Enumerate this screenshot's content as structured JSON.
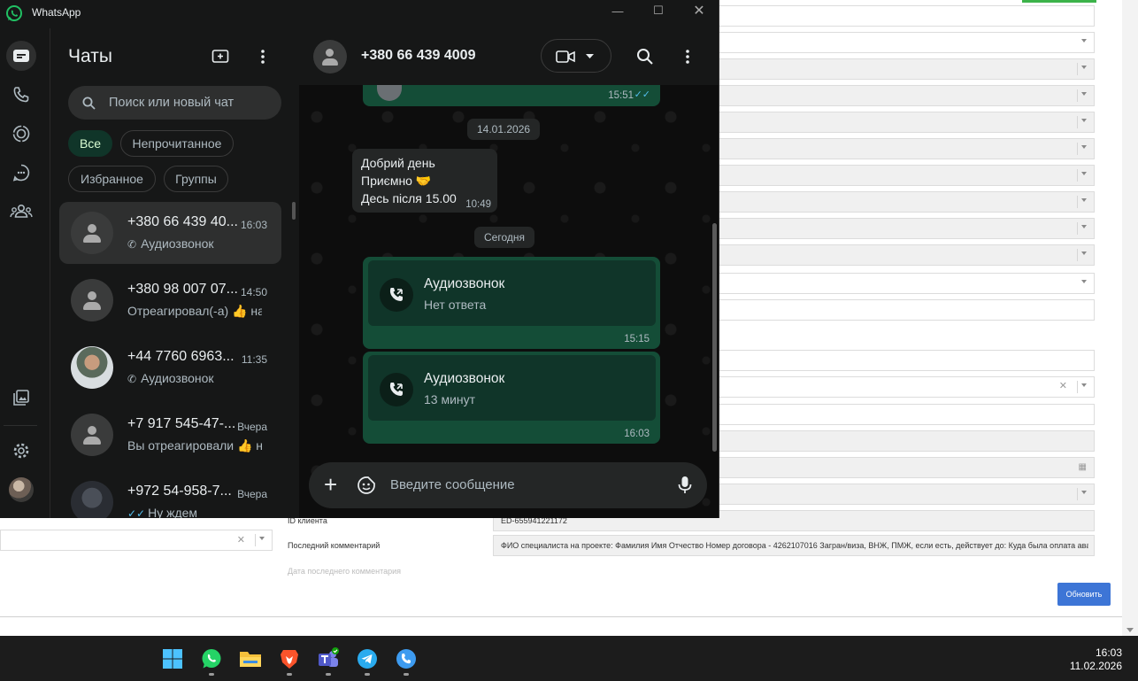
{
  "window": {
    "title": "WhatsApp"
  },
  "chat_list": {
    "title": "Чаты",
    "search_placeholder": "Поиск или новый чат",
    "filters": [
      "Все",
      "Непрочитанное",
      "Избранное",
      "Группы"
    ],
    "chats": [
      {
        "name": "+380 66 439 40...",
        "time": "16:03",
        "preview": "Аудиозвонок",
        "selected": true
      },
      {
        "name": "+380 98 007 07...",
        "time": "14:50",
        "preview": "Отреагировал(-а) 👍 на"
      },
      {
        "name": "+44 7760 6963...",
        "time": "11:35",
        "preview": "Аудиозвонок"
      },
      {
        "name": "+7 917 545-47-...",
        "time": "Вчера",
        "preview": "Вы отреагировали 👍 н"
      },
      {
        "name": "+972 54-958-7...",
        "time": "Вчера",
        "preview": "Ну ждем"
      }
    ]
  },
  "conversation": {
    "contact": "+380 66 439 4009",
    "top_time": "15:51",
    "date1": "14.01.2026",
    "incoming": {
      "lines": [
        "Добрий день",
        "Приємно 🤝",
        "Десь після 15.00"
      ],
      "time": "10:49"
    },
    "date2": "Сегодня",
    "calls": [
      {
        "title": "Аудиозвонок",
        "status": "Нет ответа",
        "time": "15:15"
      },
      {
        "title": "Аудиозвонок",
        "status": "13 минут",
        "time": "16:03"
      }
    ],
    "composer_placeholder": "Введите сообщение"
  },
  "background_form": {
    "labels": [
      "ID клиента",
      "Последний комментарий",
      "Дата последнего комментария"
    ],
    "client_id": "ED-655941221172",
    "last_comment": "ФИО специалиста на проекте: Фамилия Имя Отчество    Номер договора - 4262107016 Загран/виза, ВНЖ, ПМЖ, если есть, действует до: Куда была оплата аванса(офи",
    "update_button": "Обновить"
  },
  "taskbar": {
    "time": "16:03",
    "date": "11.02.2026"
  },
  "colors": {
    "accent": "#21c063",
    "bubble_out": "#144d37",
    "bubble_in": "#242626",
    "chip_active": "#103529"
  }
}
